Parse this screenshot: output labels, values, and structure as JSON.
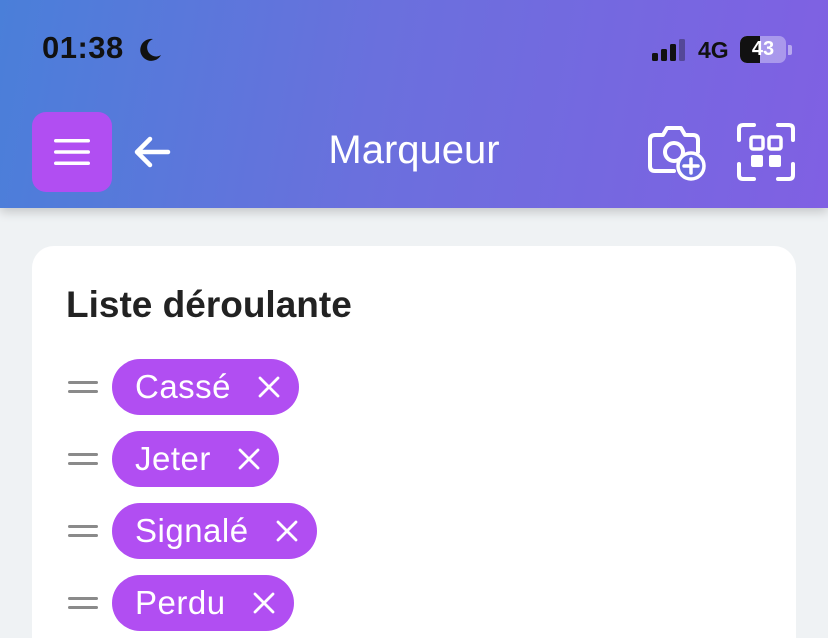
{
  "status_bar": {
    "time": "01:38",
    "network": "4G",
    "battery_level": "43",
    "battery_fraction": 0.43,
    "icons": [
      "moon-icon",
      "cellular-signal-icon",
      "battery-icon"
    ]
  },
  "header": {
    "title": "Marqueur",
    "background_colors": [
      "#4a7fd9",
      "#8060e3"
    ],
    "icons": [
      "hamburger-menu-icon",
      "back-arrow-icon",
      "camera-add-icon",
      "qr-scan-icon"
    ]
  },
  "card": {
    "title": "Liste déroulante",
    "tags": [
      {
        "label": "Cassé"
      },
      {
        "label": "Jeter"
      },
      {
        "label": "Signalé"
      },
      {
        "label": "Perdu"
      }
    ]
  },
  "colors": {
    "accent": "#b14ef2",
    "background": "#eff2f4",
    "card": "#ffffff"
  }
}
